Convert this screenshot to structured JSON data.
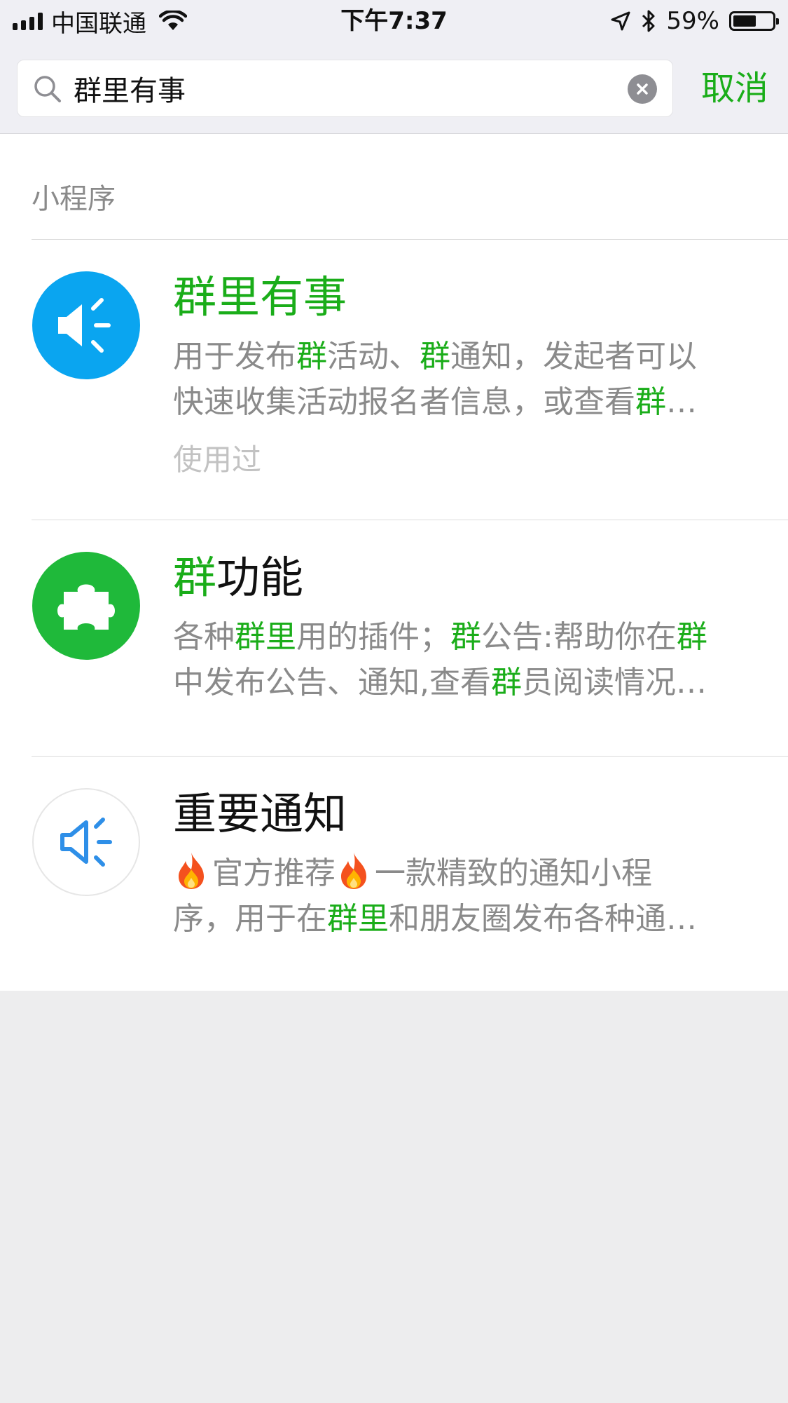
{
  "status_bar": {
    "carrier": "中国联通",
    "time": "下午7:37",
    "battery_text": "59%",
    "battery_level": 0.59
  },
  "search": {
    "query": "群里有事",
    "cancel_label": "取消"
  },
  "section": {
    "title": "小程序"
  },
  "results": [
    {
      "title": [
        {
          "text": "群里有事",
          "hl": true
        }
      ],
      "desc_lines": [
        [
          {
            "text": "用于发布"
          },
          {
            "text": "群",
            "hl": true
          },
          {
            "text": "活动、"
          },
          {
            "text": "群",
            "hl": true
          },
          {
            "text": "通知，发起者可以"
          }
        ],
        [
          {
            "text": "快速收集活动报名者信息，或查看"
          },
          {
            "text": "群",
            "hl": true
          },
          {
            "text": "…"
          }
        ]
      ],
      "meta": "使用过",
      "icon": "megaphone-icon",
      "icon_color": "#0aa5f0"
    },
    {
      "title": [
        {
          "text": "群",
          "hl": true
        },
        {
          "text": "功能"
        }
      ],
      "desc_lines": [
        [
          {
            "text": "各种"
          },
          {
            "text": "群里",
            "hl": true
          },
          {
            "text": "用的插件；"
          },
          {
            "text": "群",
            "hl": true
          },
          {
            "text": "公告:帮助你在"
          },
          {
            "text": "群",
            "hl": true
          }
        ],
        [
          {
            "text": "中发布公告、通知,查看"
          },
          {
            "text": "群",
            "hl": true
          },
          {
            "text": "员阅读情况…"
          }
        ]
      ],
      "icon": "puzzle-icon",
      "icon_color": "#1fb93a"
    },
    {
      "title": [
        {
          "text": "重要通知"
        }
      ],
      "desc_lines": [
        [
          {
            "flame": true
          },
          {
            "text": "官方推荐"
          },
          {
            "flame": true
          },
          {
            "text": "一款精致的通知小程"
          }
        ],
        [
          {
            "text": "序，用于在"
          },
          {
            "text": "群里",
            "hl": true
          },
          {
            "text": "和朋友圈发布各种通…"
          }
        ]
      ],
      "icon": "speaker-outline-icon",
      "icon_color": "#2e8fe8"
    }
  ],
  "colors": {
    "accent_green": "#1aad19",
    "secondary_text": "#8a8a8a"
  }
}
